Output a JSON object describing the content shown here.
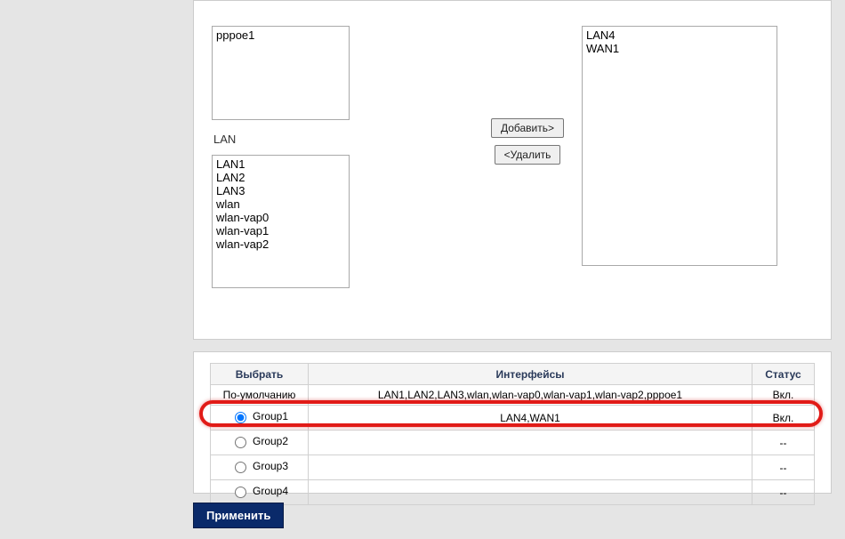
{
  "labels": {
    "lan": "LAN",
    "add": "Добавить>",
    "remove": "<Удалить",
    "apply": "Применить"
  },
  "lists": {
    "pppoe": [
      "pppoe1"
    ],
    "lan": [
      "LAN1",
      "LAN2",
      "LAN3",
      "wlan",
      "wlan-vap0",
      "wlan-vap1",
      "wlan-vap2"
    ],
    "right": [
      "LAN4",
      "WAN1"
    ]
  },
  "table": {
    "headers": {
      "select": "Выбрать",
      "interfaces": "Интерфейсы",
      "status": "Статус"
    },
    "rows": [
      {
        "select": "По-умолчанию",
        "radio": false,
        "interfaces": "LAN1,LAN2,LAN3,wlan,wlan-vap0,wlan-vap1,wlan-vap2,pppoe1",
        "status": "Вкл."
      },
      {
        "select": "Group1",
        "radio": true,
        "checked": true,
        "interfaces": "LAN4,WAN1",
        "status": "Вкл."
      },
      {
        "select": "Group2",
        "radio": true,
        "checked": false,
        "interfaces": "",
        "status": "--"
      },
      {
        "select": "Group3",
        "radio": true,
        "checked": false,
        "interfaces": "",
        "status": "--"
      },
      {
        "select": "Group4",
        "radio": true,
        "checked": false,
        "interfaces": "",
        "status": "--"
      }
    ]
  }
}
